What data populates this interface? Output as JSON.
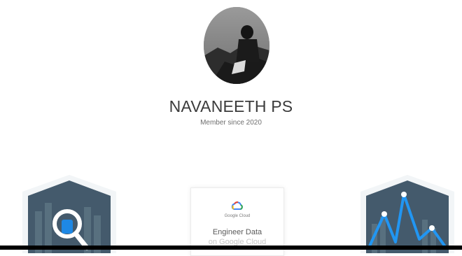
{
  "profile": {
    "name": "NAVANEETH PS",
    "member_since": "Member since 2020"
  },
  "badges": {
    "left": {
      "icon": "data-search-badge-icon",
      "accent": "#1e88e5"
    },
    "center": {
      "brand": "Google Cloud",
      "title_line1": "Engineer Data",
      "title_line2": "on Google Cloud"
    },
    "right": {
      "icon": "analytics-peaks-badge-icon",
      "accent": "#2196f3"
    }
  },
  "colors": {
    "badge_dark": "#445a6c",
    "badge_border": "#e7eef3",
    "bar": "#000000"
  }
}
